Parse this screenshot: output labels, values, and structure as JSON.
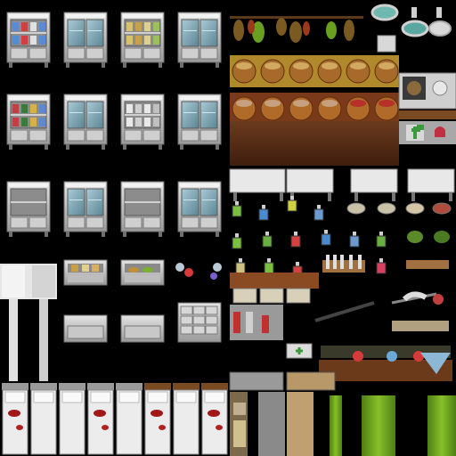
{
  "sheet": {
    "kind": "tileset",
    "theme": "hospital / medical / pharmacy interior tiles",
    "background": "#000000"
  },
  "palette": {
    "cabinet_frame": "#c9c9c9",
    "cabinet_shadow": "#6f6f6f",
    "glass": "#7fa6b3",
    "wood_dark": "#5a2f1a",
    "wood_mid": "#8a4a22",
    "brass": "#c69a3a",
    "curtain_green": "#6aa220",
    "bed_sheet": "#e9e9e9",
    "blood_red": "#a01818",
    "cross_green": "#3c9a3c"
  },
  "cabinets": [
    {
      "name": "cabinet-bottles",
      "row": 0,
      "col": 0,
      "variant": "bottles"
    },
    {
      "name": "cabinet-glass",
      "row": 0,
      "col": 1,
      "variant": "glass"
    },
    {
      "name": "cabinet-jars",
      "row": 0,
      "col": 2,
      "variant": "jars"
    },
    {
      "name": "cabinet-glass-2",
      "row": 0,
      "col": 3,
      "variant": "glass"
    },
    {
      "name": "cabinet-books",
      "row": 1,
      "col": 0,
      "variant": "books"
    },
    {
      "name": "cabinet-glass-3",
      "row": 1,
      "col": 1,
      "variant": "glass"
    },
    {
      "name": "cabinet-dishes",
      "row": 1,
      "col": 2,
      "variant": "dishes"
    },
    {
      "name": "cabinet-glass-4",
      "row": 1,
      "col": 3,
      "variant": "glass"
    },
    {
      "name": "cabinet-empty",
      "row": 2,
      "col": 0,
      "variant": "empty"
    },
    {
      "name": "cabinet-glass-5",
      "row": 2,
      "col": 1,
      "variant": "glass"
    },
    {
      "name": "cabinet-empty-2",
      "row": 2,
      "col": 2,
      "variant": "empty"
    },
    {
      "name": "cabinet-glass-6",
      "row": 2,
      "col": 3,
      "variant": "glass"
    }
  ],
  "beds": [
    "bed-bloody",
    "bed-plain",
    "bed-plain",
    "bed-bloody",
    "bed-plain",
    "bed-wood-bloody",
    "bed-wood",
    "bed-wood-bloody"
  ],
  "pots_row1": [
    "clay-pot",
    "clay-pot",
    "clay-pot",
    "clay-pot",
    "clay-pot",
    "clay-pot"
  ],
  "pots_row2": [
    "soup-pot",
    "soup-pot",
    "soup-pot",
    "soup-pot",
    "blood-pot",
    "blood-pot"
  ]
}
